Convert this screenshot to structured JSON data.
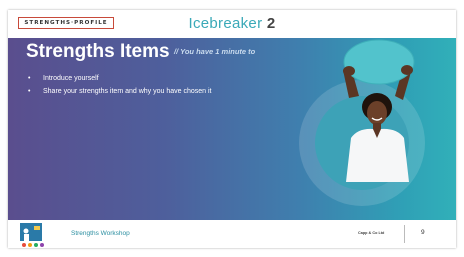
{
  "header": {
    "logo_text": "STRENGTHS·PROFILE",
    "title_main": "Icebreaker",
    "title_num": "2"
  },
  "main": {
    "title": "Strengths Items",
    "subtitle": "// You have 1 minute to",
    "bullets": [
      "Introduce yourself",
      "Share your strengths item and why you have chosen it"
    ]
  },
  "footer": {
    "title": "Strengths Workshop",
    "brand": "Capp & Co Ltd",
    "page": "9"
  },
  "colors": {
    "accent": "#3aa9b8",
    "band_left": "#5a4e8e",
    "band_right": "#31b0b9",
    "logo_border": "#c84a3a"
  }
}
